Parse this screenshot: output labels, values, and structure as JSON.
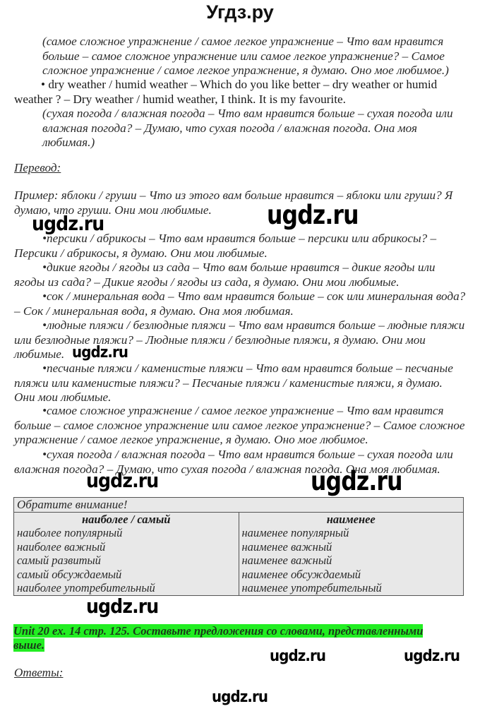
{
  "site_title": "Угдз.ру",
  "intro_block": {
    "ru_translation_1": "(самое сложное упражнение / самое легкое упражнение – Что вам нравится больше – самое сложное упражнение или самое легкое упражнение? – Самое сложное упражнение / самое легкое упражнение, я думаю. Оно мое любимое.)",
    "en_item": "• dry weather / humid weather – Which do you like better – dry weather or humid weather ? – Dry weather / humid weather, I think. It is my favourite.",
    "ru_translation_2": "(сухая погода / влажная погода – Что вам нравится больше – сухая погода или влажная погода? – Думаю, что сухая погода / влажная погода. Она моя любимая.)"
  },
  "translation_section": {
    "heading": "Перевод:",
    "example": "Пример: яблоки / груши – Что из этого вам больше нравится – яблоки или груши? Я думаю, что груши. Они мои любимые.",
    "items": [
      "•персики / абрикосы – Что вам нравится больше – персики или абрикосы? – Персики / абрикосы, я думаю. Они мои любимые.",
      "•дикие ягоды / ягоды из сада – Что вам больше нравится – дикие ягоды или ягоды из сада? – Дикие ягоды / ягоды из сада, я думаю. Они мои любимые.",
      "•сок / минеральная вода – Что вам нравится больше – сок или минеральная вода? – Сок / минеральная вода, я думаю. Она моя любимая.",
      "•людные пляжи / безлюдные пляжи – Что вам нравится больше – людные пляжи или безлюдные пляжи? – Людные пляжи / безлюдные пляжи, я думаю. Они мои любимые.",
      "•песчаные пляжи / каменистые пляжи – Что вам нравится больше – песчаные пляжи или каменистые пляжи? – Песчаные пляжи / каменистые пляжи, я думаю. Они мои любимые.",
      "•самое сложное упражнение / самое легкое упражнение – Что вам нравится больше – самое сложное упражнение или самое легкое упражнение? – Самое сложное упражнение / самое легкое упражнение, я думаю. Оно мое любимое.",
      "•сухая погода / влажная погода – Что вам нравится больше – сухая погода или влажная погода? – Думаю, что сухая погода / влажная погода. Она моя любимая."
    ]
  },
  "note_table": {
    "title": "Обратите внимание!",
    "headers": [
      "наиболее / самый",
      "наименее"
    ],
    "rows": [
      [
        "наиболее популярный",
        "наименее популярный"
      ],
      [
        "наиболее важный",
        "наименее важный"
      ],
      [
        "самый развитый",
        "наименее важный"
      ],
      [
        "самый обсуждаемый",
        "наименее обсуждаемый"
      ],
      [
        "наиболее употребительный",
        "наименее употребительный"
      ]
    ]
  },
  "task": {
    "text": "Unit 20 ex. 14 стр. 125. Составьте предложения со словами, представленными выше.",
    "highlight_color": "#22ee22"
  },
  "answers_heading": "Ответы:",
  "watermark": "ugdz.ru"
}
